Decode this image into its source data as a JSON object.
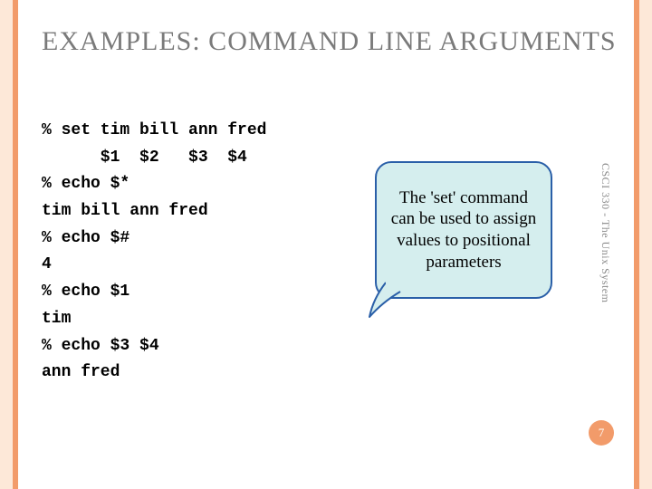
{
  "title": "EXAMPLES: COMMAND LINE ARGUMENTS",
  "code": "% set tim bill ann fred\n      $1  $2   $3  $4\n% echo $*\ntim bill ann fred\n% echo $#\n4\n% echo $1\ntim\n% echo $3 $4\nann fred",
  "callout": "The 'set' command can be used to assign values to positional parameters",
  "sidebar": "CSCI 330 - The Unix System",
  "page": "7"
}
